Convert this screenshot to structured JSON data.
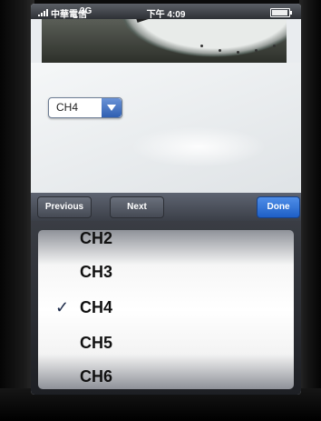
{
  "status_bar": {
    "carrier": "中華電信",
    "network": "3G",
    "time": "下午 4:09",
    "battery_level": 0.85
  },
  "channel_select": {
    "selected": "CH4"
  },
  "toolbar": {
    "previous_label": "Previous",
    "next_label": "Next",
    "done_label": "Done"
  },
  "picker": {
    "items": [
      "CH2",
      "CH3",
      "CH4",
      "CH5",
      "CH6"
    ],
    "selected": "CH4",
    "check_mark": "✓"
  },
  "colors": {
    "done_button": "#1e5fc6",
    "select_arrow": "#2f5fb2"
  },
  "icons": [
    "signal-icon",
    "battery-icon",
    "chevron-down-icon",
    "check-icon"
  ]
}
